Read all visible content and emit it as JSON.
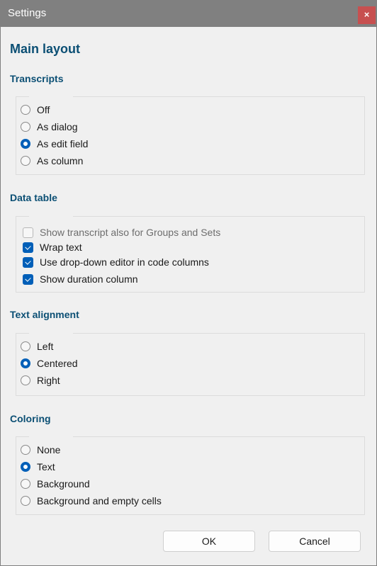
{
  "window": {
    "title": "Settings",
    "close_label": "×"
  },
  "heading": "Main layout",
  "transcripts": {
    "title": "Transcripts",
    "options": [
      {
        "label": "Off",
        "selected": false
      },
      {
        "label": "As dialog",
        "selected": false
      },
      {
        "label": "As edit field",
        "selected": true
      },
      {
        "label": "As column",
        "selected": false
      }
    ]
  },
  "data_table": {
    "title": "Data table",
    "options": [
      {
        "label": "Show transcript also for Groups and Sets",
        "checked": false,
        "enabled": false
      },
      {
        "label": "Wrap text",
        "checked": true,
        "enabled": true
      },
      {
        "label": "Use drop-down editor in code columns",
        "checked": true,
        "enabled": true
      },
      {
        "label": "Show duration column",
        "checked": true,
        "enabled": true
      }
    ]
  },
  "text_alignment": {
    "title": "Text alignment",
    "options": [
      {
        "label": "Left",
        "selected": false
      },
      {
        "label": "Centered",
        "selected": true
      },
      {
        "label": "Right",
        "selected": false
      }
    ]
  },
  "coloring": {
    "title": "Coloring",
    "options": [
      {
        "label": "None",
        "selected": false
      },
      {
        "label": "Text",
        "selected": true
      },
      {
        "label": "Background",
        "selected": false
      },
      {
        "label": "Background and empty cells",
        "selected": false
      }
    ]
  },
  "buttons": {
    "ok": "OK",
    "cancel": "Cancel"
  },
  "colors": {
    "accent": "#005fb8",
    "heading": "#0b4f74",
    "titlebar": "#808080",
    "close": "#c75050"
  }
}
